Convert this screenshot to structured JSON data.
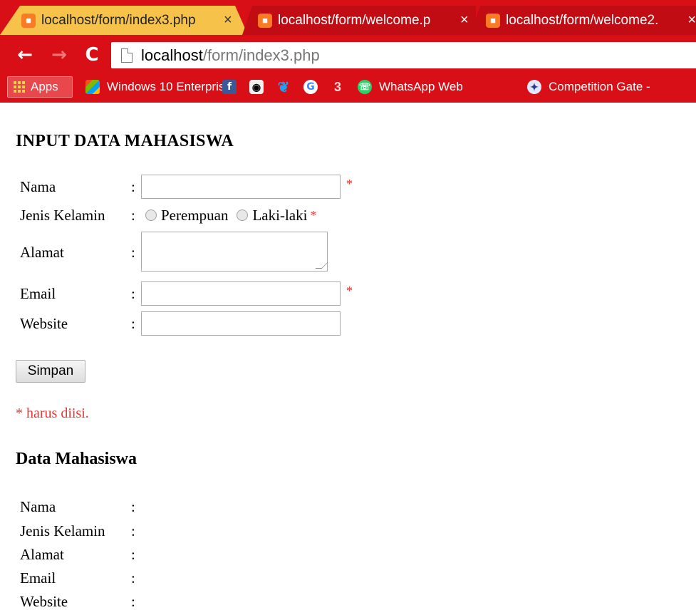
{
  "browser": {
    "tabs": [
      {
        "title": "localhost/form/index3.php",
        "active": true
      },
      {
        "title": "localhost/form/welcome.p",
        "active": false
      },
      {
        "title": "localhost/form/welcome2.",
        "active": false
      }
    ],
    "favicon_glyph": "■",
    "close_glyph": "×",
    "nav": {
      "back": "←",
      "forward": "→",
      "reload": "C"
    },
    "address": {
      "host": "localhost",
      "path": "/form/index3.php"
    },
    "bookmarks": {
      "apps": "Apps",
      "windows": "Windows 10 Enterpris",
      "whatsapp": "WhatsApp Web",
      "competition": "Competition Gate -"
    },
    "bookmark_icons": [
      "windows-icon",
      "facebook-icon",
      "app-icon",
      "twitter-icon",
      "google-icon",
      "three-icon",
      "whatsapp-icon",
      "competition-icon"
    ],
    "colors": {
      "chrome": "#d80f16",
      "active_tab": "#f6c24a",
      "required": "#e53935"
    }
  },
  "form": {
    "title": "INPUT DATA MAHASISWA",
    "colon": ":",
    "required_mark": "*",
    "fields": {
      "nama": {
        "label": "Nama",
        "value": ""
      },
      "jenis_kelamin": {
        "label": "Jenis Kelamin",
        "options": [
          "Perempuan",
          "Laki-laki"
        ]
      },
      "alamat": {
        "label": "Alamat",
        "value": ""
      },
      "email": {
        "label": "Email",
        "value": ""
      },
      "website": {
        "label": "Website",
        "value": ""
      }
    },
    "submit_label": "Simpan",
    "required_note": "* harus diisi."
  },
  "output": {
    "title": "Data Mahasiswa",
    "rows": [
      {
        "label": "Nama",
        "value": ""
      },
      {
        "label": "Jenis Kelamin",
        "value": ""
      },
      {
        "label": "Alamat",
        "value": ""
      },
      {
        "label": "Email",
        "value": ""
      },
      {
        "label": "Website",
        "value": ""
      }
    ]
  }
}
